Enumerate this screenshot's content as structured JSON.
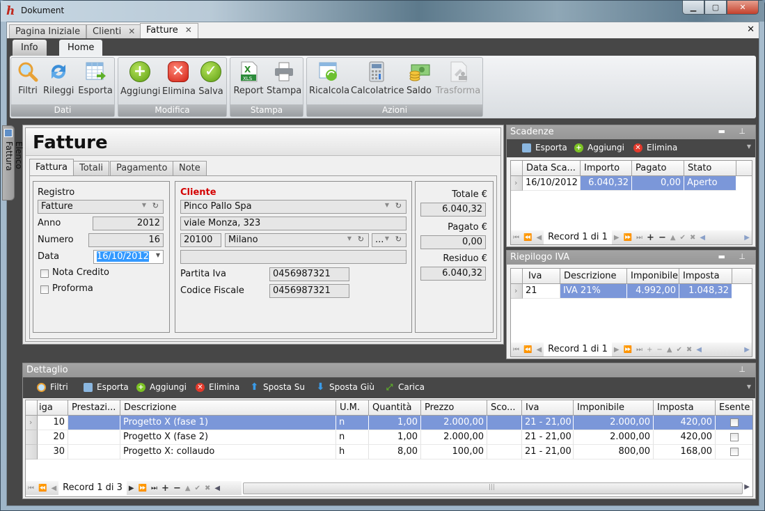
{
  "window": {
    "title": "Dokument",
    "app_icon": "h",
    "controls": {
      "minimize": "▁",
      "maximize": "▢",
      "close": "✕"
    }
  },
  "doc_tabs": [
    {
      "label": "Pagina Iniziale",
      "closable": false
    },
    {
      "label": "Clienti",
      "closable": true
    },
    {
      "label": "Fatture",
      "closable": true,
      "active": true
    }
  ],
  "close_all": "✕",
  "ribbon": {
    "tabs": [
      {
        "label": "Info"
      },
      {
        "label": "Home",
        "active": true
      }
    ],
    "groups": [
      {
        "title": "Dati",
        "buttons": [
          {
            "label": "Filtri",
            "icon": "search-icon"
          },
          {
            "label": "Rileggi",
            "icon": "refresh-icon"
          },
          {
            "label": "Esporta",
            "icon": "export-table-icon"
          }
        ]
      },
      {
        "title": "Modifica",
        "buttons": [
          {
            "label": "Aggiungi",
            "icon": "add-icon"
          },
          {
            "label": "Elimina",
            "icon": "delete-icon"
          },
          {
            "label": "Salva",
            "icon": "save-check-icon"
          }
        ]
      },
      {
        "title": "Stampa",
        "buttons": [
          {
            "label": "Report",
            "icon": "xls-report-icon"
          },
          {
            "label": "Stampa",
            "icon": "printer-icon"
          }
        ]
      },
      {
        "title": "Azioni",
        "buttons": [
          {
            "label": "Ricalcola",
            "icon": "recalculate-icon"
          },
          {
            "label": "Calcolatrice",
            "icon": "calculator-icon"
          },
          {
            "label": "Saldo",
            "icon": "money-icon"
          },
          {
            "label": "Trasforma",
            "icon": "stamp-icon",
            "disabled": true
          }
        ]
      }
    ]
  },
  "side_tab": {
    "label": "Elenco Fattura"
  },
  "form": {
    "title": "Fatture",
    "tabs": [
      "Fattura",
      "Totali",
      "Pagamento",
      "Note"
    ],
    "registro": {
      "label": "Registro",
      "value": "Fatture"
    },
    "anno": {
      "label": "Anno",
      "value": "2012"
    },
    "numero": {
      "label": "Numero",
      "value": "16"
    },
    "data": {
      "label": "Data",
      "value": "16/10/2012"
    },
    "nota_credito": {
      "label": "Nota Credito",
      "checked": false
    },
    "proforma": {
      "label": "Proforma",
      "checked": false
    },
    "cliente": {
      "label": "Cliente",
      "label_color": "#d40000",
      "name": "Pinco Pallo Spa",
      "address": "viale Monza, 323",
      "cap": "20100",
      "city": "Milano",
      "province": "...",
      "extra": "",
      "partita_iva_label": "Partita Iva",
      "partita_iva": "0456987321",
      "codice_fiscale_label": "Codice Fiscale",
      "codice_fiscale": "0456987321"
    },
    "totals": {
      "totale_label": "Totale €",
      "totale": "6.040,32",
      "pagato_label": "Pagato €",
      "pagato": "0,00",
      "residuo_label": "Residuo €",
      "residuo": "6.040,32"
    }
  },
  "scadenze": {
    "title": "Scadenze",
    "toolbar": [
      "Esporta",
      "Aggiungi",
      "Elimina"
    ],
    "columns": [
      "Data Sca...",
      "Importo",
      "Pagato",
      "Stato"
    ],
    "rows": [
      [
        "16/10/2012",
        "6.040,32",
        "0,00",
        "Aperto"
      ]
    ],
    "record": "Record 1 di 1"
  },
  "riepilogo_iva": {
    "title": "Riepilogo IVA",
    "columns": [
      "Iva",
      "Descrizione",
      "Imponibile",
      "Imposta"
    ],
    "rows": [
      [
        "21",
        "IVA 21%",
        "4.992,00",
        "1.048,32"
      ]
    ],
    "record": "Record 1 di 1"
  },
  "dettaglio": {
    "title": "Dettaglio",
    "toolbar": [
      "Filtri",
      "Esporta",
      "Aggiungi",
      "Elimina",
      "Sposta Su",
      "Sposta Giù",
      "Carica"
    ],
    "columns": [
      "iga",
      "Prestazi...",
      "Descrizione",
      "U.M.",
      "Quantità",
      "Prezzo",
      "Sco...",
      "Iva",
      "Imponibile",
      "Imposta",
      "Esente"
    ],
    "rows": [
      [
        "10",
        "",
        "Progetto X (fase 1)",
        "n",
        "1,00",
        "2.000,00",
        "",
        "21 - 21,00",
        "2.000,00",
        "420,00",
        false
      ],
      [
        "20",
        "",
        "Progetto X (fase 2)",
        "n",
        "1,00",
        "2.000,00",
        "",
        "21 - 21,00",
        "2.000,00",
        "420,00",
        false
      ],
      [
        "30",
        "",
        "Progetto X: collaudo",
        "h",
        "8,00",
        "100,00",
        "",
        "21 - 21,00",
        "800,00",
        "168,00",
        false
      ]
    ],
    "record": "Record 1 di 3"
  },
  "colors": {
    "selection": "#7b97d9",
    "highlight": "#3399ff",
    "dark_bg": "#474747"
  }
}
